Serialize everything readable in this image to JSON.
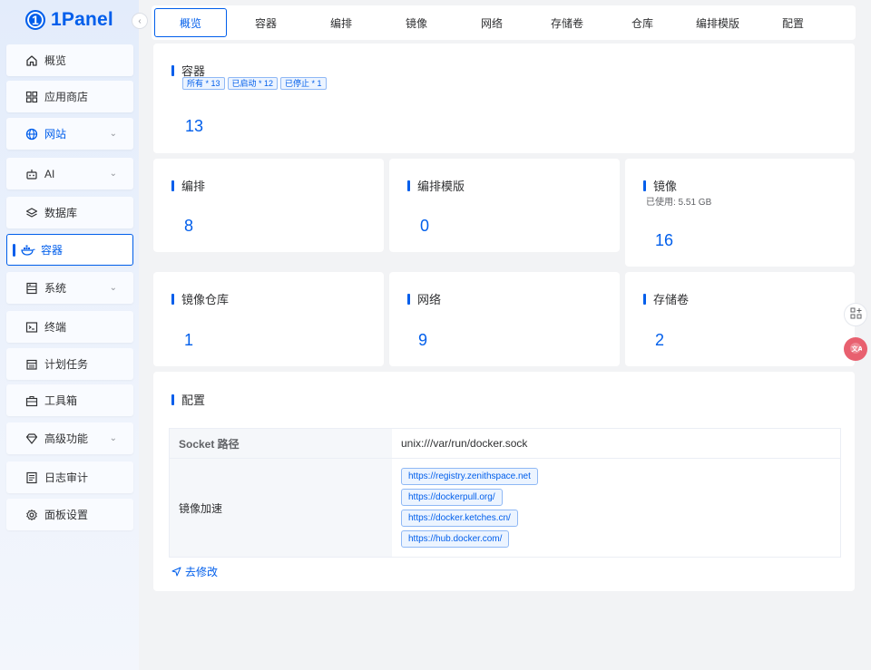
{
  "app": {
    "logo_text": "1Panel",
    "logo_mark": "1"
  },
  "sidebar": {
    "items": [
      {
        "label": "概览",
        "icon": "home-icon"
      },
      {
        "label": "应用商店",
        "icon": "grid-icon"
      },
      {
        "label": "网站",
        "icon": "globe-icon",
        "expandable": true
      },
      {
        "label": "AI",
        "icon": "robot-icon",
        "expandable": true
      },
      {
        "label": "数据库",
        "icon": "layers-icon"
      },
      {
        "label": "容器",
        "icon": "docker-icon",
        "active": true
      },
      {
        "label": "系统",
        "icon": "server-icon",
        "expandable": true
      },
      {
        "label": "终端",
        "icon": "terminal-icon"
      },
      {
        "label": "计划任务",
        "icon": "calendar-icon"
      },
      {
        "label": "工具箱",
        "icon": "toolbox-icon"
      },
      {
        "label": "高级功能",
        "icon": "diamond-icon",
        "expandable": true
      },
      {
        "label": "日志审计",
        "icon": "log-icon"
      },
      {
        "label": "面板设置",
        "icon": "gear-icon"
      }
    ]
  },
  "tabs": [
    {
      "label": "概览",
      "active": true
    },
    {
      "label": "容器"
    },
    {
      "label": "编排"
    },
    {
      "label": "镜像"
    },
    {
      "label": "网络"
    },
    {
      "label": "存储卷"
    },
    {
      "label": "仓库"
    },
    {
      "label": "编排模版"
    },
    {
      "label": "配置"
    }
  ],
  "cards": {
    "containers": {
      "title": "容器",
      "count": "13",
      "tags": [
        "所有 * 13",
        "已启动 * 12",
        "已停止 * 1"
      ]
    },
    "compose": {
      "title": "编排",
      "count": "8"
    },
    "compose_templates": {
      "title": "编排模版",
      "count": "0"
    },
    "images": {
      "title": "镜像",
      "subtitle": "已使用: 5.51 GB",
      "count": "16"
    },
    "image_repos": {
      "title": "镜像仓库",
      "count": "1"
    },
    "networks": {
      "title": "网络",
      "count": "9"
    },
    "volumes": {
      "title": "存储卷",
      "count": "2"
    }
  },
  "config": {
    "title": "配置",
    "socket_label": "Socket 路径",
    "socket_value": "unix:///var/run/docker.sock",
    "mirror_label": "镜像加速",
    "mirrors": [
      "https://registry.zenithspace.net",
      "https://dockerpull.org/",
      "https://docker.ketches.cn/",
      "https://hub.docker.com/"
    ],
    "edit_label": "去修改"
  },
  "colors": {
    "accent": "#005eeb",
    "background": "#f2f3f5",
    "card": "#ffffff",
    "translate_button": "#e8606f"
  }
}
